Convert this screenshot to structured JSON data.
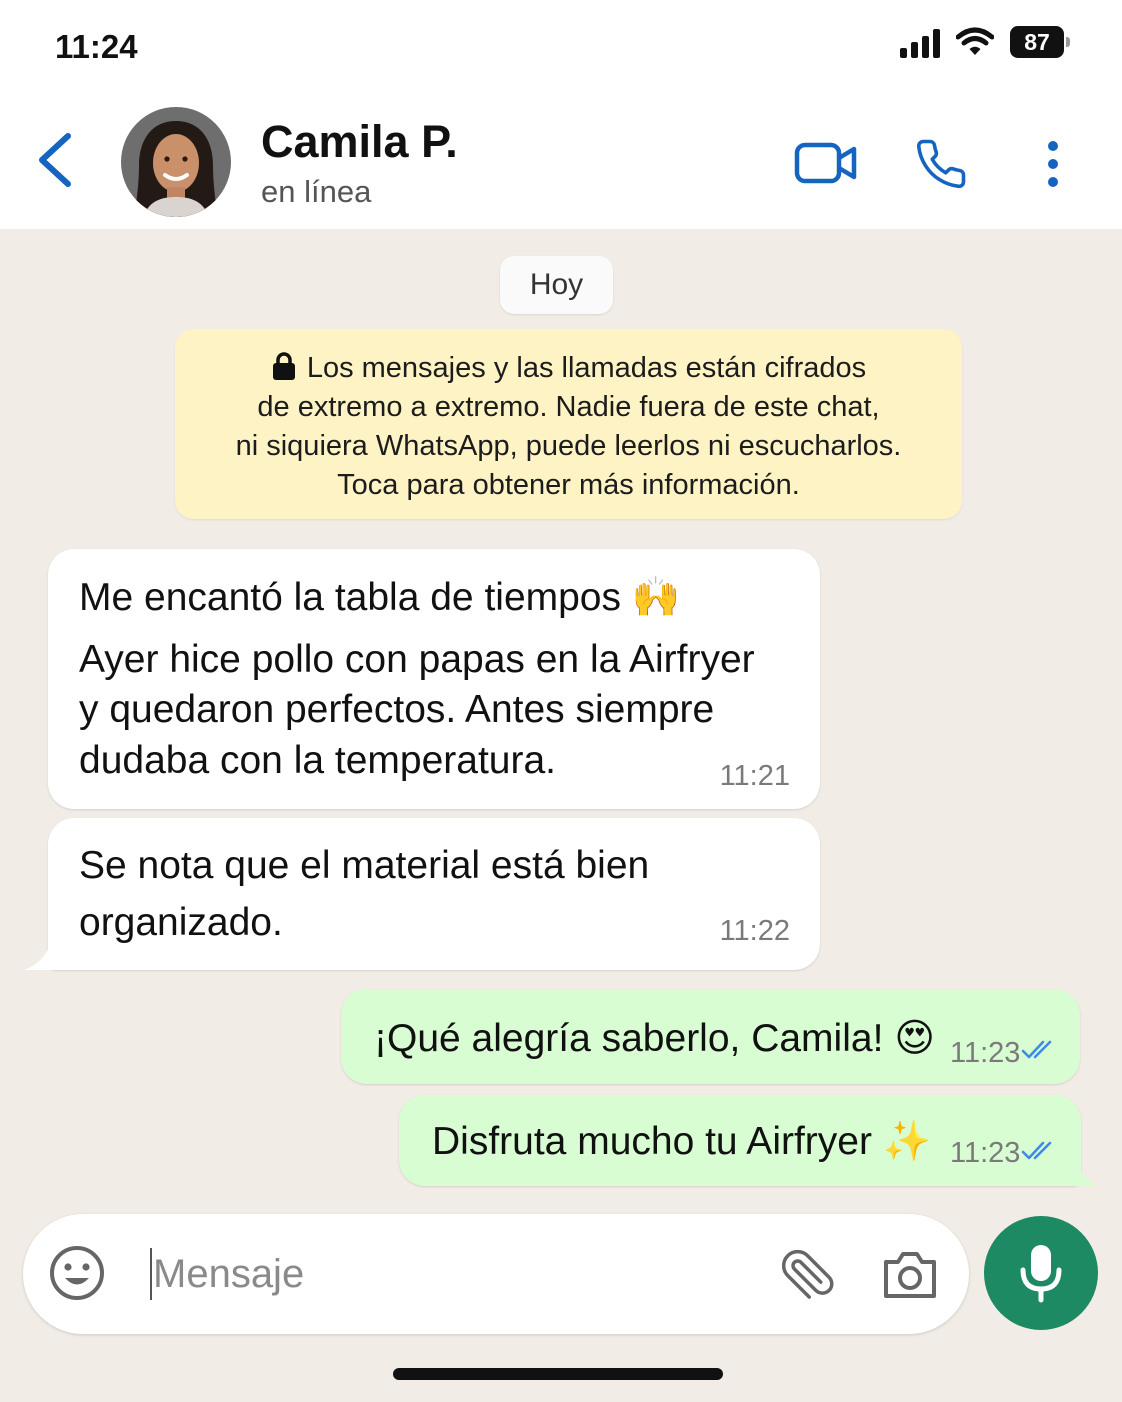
{
  "status_bar": {
    "time": "11:24",
    "battery": "87"
  },
  "header": {
    "contact_name": "Camila P.",
    "contact_status": "en línea"
  },
  "chat": {
    "date_label": "Hoy",
    "encryption_notice": [
      "Los mensajes y las llamadas están cifrados",
      "de extremo a extremo. Nadie fuera de este chat,",
      "ni siquiera WhatsApp, puede leerlos ni escucharlos.",
      "Toca para obtener más información."
    ],
    "messages": [
      {
        "direction": "incoming",
        "lines": [
          "Me encantó la tabla de tiempos 🙌",
          "Ayer hice pollo con papas en la Airfryer",
          "y quedaron perfectos. Antes siempre",
          "dudaba con la temperatura."
        ],
        "time": "11:21"
      },
      {
        "direction": "incoming",
        "lines": [
          "Se nota que el material está bien",
          "organizado."
        ],
        "time": "11:22"
      },
      {
        "direction": "outgoing",
        "lines": [
          "¡Qué alegría saberlo, Camila! 😍"
        ],
        "time": "11:23",
        "status": "read"
      },
      {
        "direction": "outgoing",
        "lines": [
          "Disfruta mucho tu Airfryer ✨"
        ],
        "time": "11:23",
        "status": "read"
      }
    ]
  },
  "composer": {
    "placeholder": "Mensaje"
  },
  "colors": {
    "accent": "#1565c0",
    "mic_button": "#1d8a63",
    "outgoing_bubble": "#d9fdd3",
    "incoming_bubble": "#ffffff",
    "notice_bg": "#fdf3c4",
    "read_ticks": "#3d8be8"
  },
  "icons": [
    "back-icon",
    "video-call-icon",
    "phone-icon",
    "more-options-icon",
    "lock-icon",
    "emoji-icon",
    "attach-icon",
    "camera-icon",
    "mic-icon",
    "double-check-icon"
  ]
}
